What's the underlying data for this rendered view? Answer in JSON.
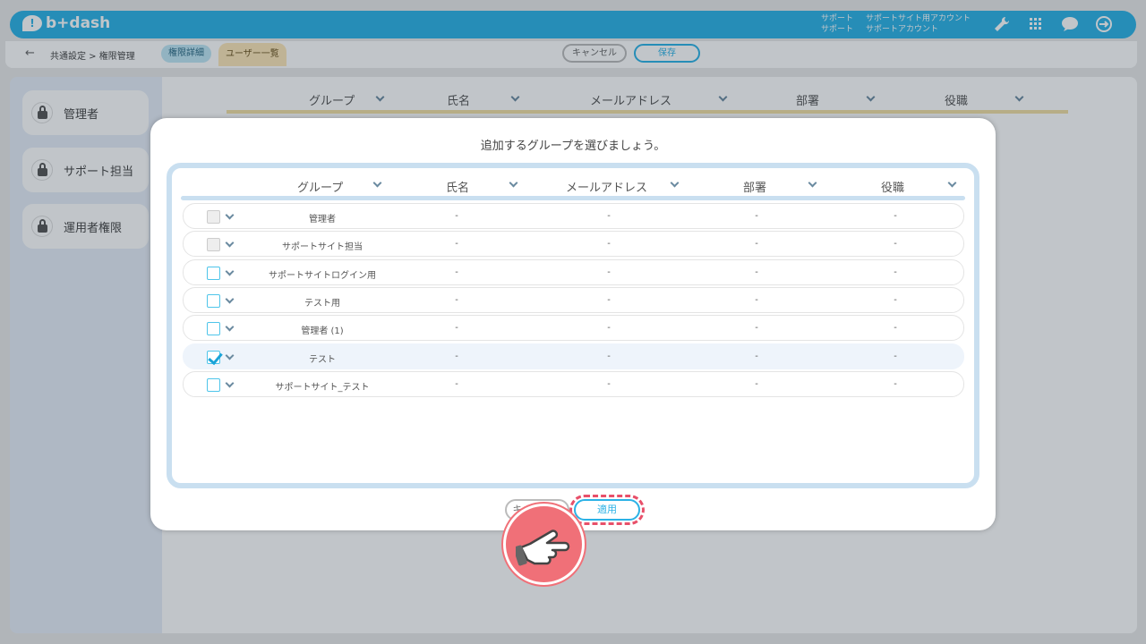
{
  "app": {
    "logo_text": "b+dash",
    "account": {
      "label1": "サポート",
      "value1": "サポートサイト用アカウント",
      "label2": "サポート",
      "value2": "サポートアカウント"
    }
  },
  "subbar": {
    "breadcrumb": "共通設定 > 権限管理",
    "tab_detail": "権限詳細",
    "tab_users": "ユーザー一覧",
    "cancel_label": "キャンセル",
    "save_label": "保存"
  },
  "sidebar": {
    "items": [
      {
        "label": "管理者"
      },
      {
        "label": "サポート担当"
      },
      {
        "label": "運用者権限"
      }
    ]
  },
  "main": {
    "columns": [
      "グループ",
      "氏名",
      "メールアドレス",
      "部署",
      "役職"
    ]
  },
  "modal": {
    "title": "追加するグループを選びましょう。",
    "columns": [
      "グループ",
      "氏名",
      "メールアドレス",
      "部署",
      "役職"
    ],
    "rows": [
      {
        "group": "管理者",
        "name": "-",
        "email": "-",
        "dept": "-",
        "role": "-",
        "checked": false,
        "disabled": true
      },
      {
        "group": "サポートサイト担当",
        "name": "-",
        "email": "-",
        "dept": "-",
        "role": "-",
        "checked": false,
        "disabled": true
      },
      {
        "group": "サポートサイトログイン用",
        "name": "-",
        "email": "-",
        "dept": "-",
        "role": "-",
        "checked": false,
        "disabled": false
      },
      {
        "group": "テスト用",
        "name": "-",
        "email": "-",
        "dept": "-",
        "role": "-",
        "checked": false,
        "disabled": false
      },
      {
        "group": "管理者 (1)",
        "name": "-",
        "email": "-",
        "dept": "-",
        "role": "-",
        "checked": false,
        "disabled": false
      },
      {
        "group": "テスト",
        "name": "-",
        "email": "-",
        "dept": "-",
        "role": "-",
        "checked": true,
        "disabled": false
      },
      {
        "group": "サポートサイト_テスト",
        "name": "-",
        "email": "-",
        "dept": "-",
        "role": "-",
        "checked": false,
        "disabled": false
      }
    ],
    "cancel_label": "キャンセル",
    "apply_label": "適用"
  },
  "colors": {
    "accent": "#2bb2e6",
    "highlight": "#e8506a"
  },
  "icons": {
    "header": [
      "wrench-icon",
      "apps-grid-icon",
      "chat-icon",
      "logout-icon"
    ],
    "pointer": "hand-pointer-icon"
  }
}
